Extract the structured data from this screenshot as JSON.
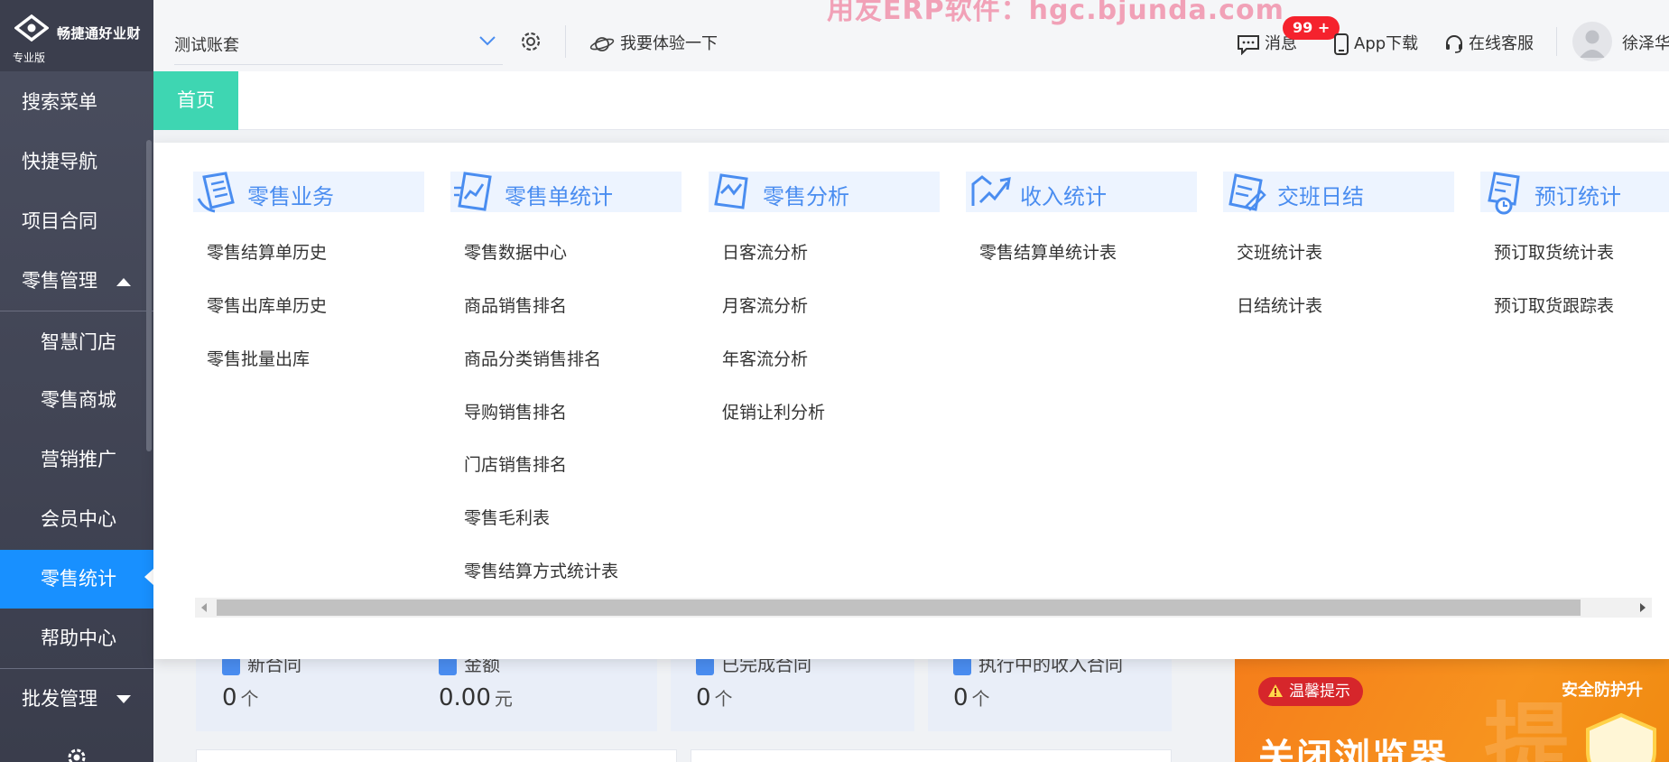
{
  "sidebar": {
    "brand": "畅捷通好业财",
    "edition": "专业版",
    "items": [
      {
        "label": "搜索菜单"
      },
      {
        "label": "快捷导航"
      },
      {
        "label": "项目合同"
      },
      {
        "label": "零售管理"
      },
      {
        "label": "智慧门店"
      },
      {
        "label": "零售商城"
      },
      {
        "label": "营销推广"
      },
      {
        "label": "会员中心"
      },
      {
        "label": "零售统计"
      },
      {
        "label": "帮助中心"
      },
      {
        "label": "批发管理"
      }
    ]
  },
  "header": {
    "watermark": "用友ERP软件：hgc.bjunda.com",
    "account_value": "测试账套",
    "try_label": "我要体验一下",
    "messages_label": "消息",
    "messages_badge": "99 +",
    "app_label": "App下载",
    "support_label": "在线客服",
    "user_name": "徐泽华"
  },
  "tabs": [
    {
      "label": "首页"
    }
  ],
  "menu_panel": {
    "columns": [
      {
        "title": "零售业务",
        "items": [
          "零售结算单历史",
          "零售出库单历史",
          "零售批量出库"
        ]
      },
      {
        "title": "零售单统计",
        "items": [
          "零售数据中心",
          "商品销售排名",
          "商品分类销售排名",
          "导购销售排名",
          "门店销售排名",
          "零售毛利表",
          "零售结算方式统计表"
        ]
      },
      {
        "title": "零售分析",
        "items": [
          "日客流分析",
          "月客流分析",
          "年客流分析",
          "促销让利分析"
        ]
      },
      {
        "title": "收入统计",
        "items": [
          "零售结算单统计表"
        ]
      },
      {
        "title": "交班日结",
        "items": [
          "交班统计表",
          "日结统计表"
        ]
      },
      {
        "title": "预订统计",
        "items": [
          "预订取货统计表",
          "预订取货跟踪表"
        ]
      }
    ]
  },
  "dashboard": {
    "stats": [
      {
        "label": "新合同",
        "value": "0",
        "unit": "个"
      },
      {
        "label": "金额",
        "value": "0.00",
        "unit": "元"
      },
      {
        "label": "已完成合同",
        "value": "0",
        "unit": "个"
      },
      {
        "label": "执行中的收入合同",
        "value": "0",
        "unit": "个"
      }
    ],
    "promo": {
      "tip": "温馨提示",
      "headline": "关闭浏览器",
      "right_text": "安全防护升",
      "ghost_char": "提"
    }
  },
  "colors": {
    "sidebar_bg": "#44485a",
    "active_blue": "#1890ff",
    "tab_green": "#3ed6b2",
    "accent_blue": "#4a8df0",
    "badge_red": "#f5222d",
    "promo_orange": "#f7931e"
  }
}
